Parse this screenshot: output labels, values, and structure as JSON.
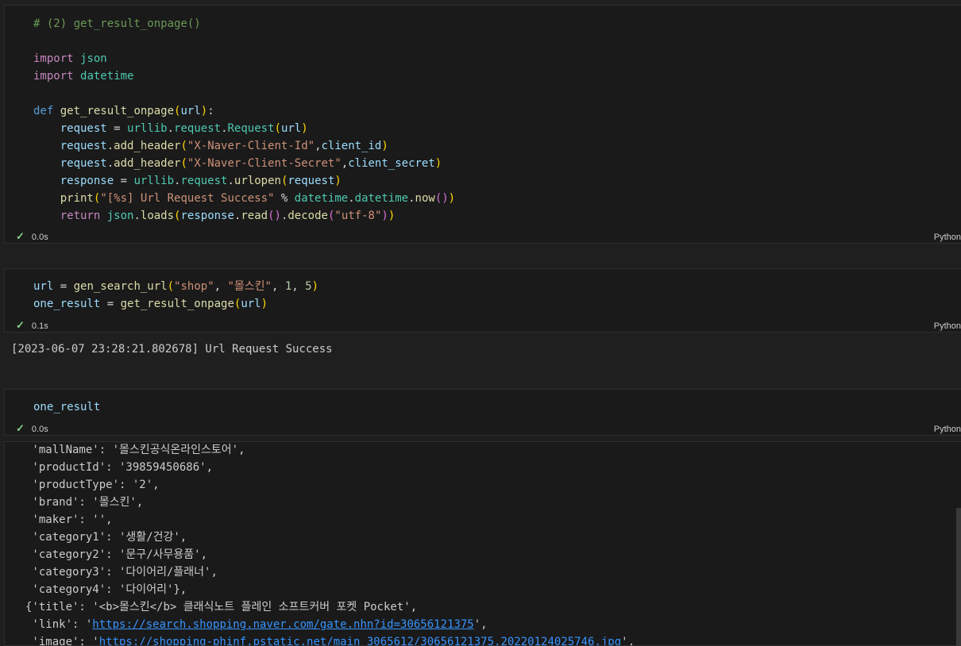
{
  "cell1": {
    "lines": [
      [
        [
          "cm",
          "# (2) get_result_onpage()"
        ]
      ],
      [],
      [
        [
          "ctl",
          "import"
        ],
        [
          "op",
          " "
        ],
        [
          "md",
          "json"
        ]
      ],
      [
        [
          "ctl",
          "import"
        ],
        [
          "op",
          " "
        ],
        [
          "md",
          "datetime"
        ]
      ],
      [],
      [
        [
          "kw",
          "def"
        ],
        [
          "op",
          " "
        ],
        [
          "fn",
          "get_result_onpage"
        ],
        [
          "b1",
          "("
        ],
        [
          "var",
          "url"
        ],
        [
          "b1",
          ")"
        ],
        [
          "op",
          ":"
        ]
      ],
      [
        [
          "op",
          "    "
        ],
        [
          "var",
          "request"
        ],
        [
          "op",
          " = "
        ],
        [
          "md",
          "urllib"
        ],
        [
          "op",
          "."
        ],
        [
          "md",
          "request"
        ],
        [
          "op",
          "."
        ],
        [
          "md",
          "Request"
        ],
        [
          "b1",
          "("
        ],
        [
          "var",
          "url"
        ],
        [
          "b1",
          ")"
        ]
      ],
      [
        [
          "op",
          "    "
        ],
        [
          "var",
          "request"
        ],
        [
          "op",
          "."
        ],
        [
          "fn",
          "add_header"
        ],
        [
          "b1",
          "("
        ],
        [
          "str",
          "\"X-Naver-Client-Id\""
        ],
        [
          "op",
          ","
        ],
        [
          "var",
          "client_id"
        ],
        [
          "b1",
          ")"
        ]
      ],
      [
        [
          "op",
          "    "
        ],
        [
          "var",
          "request"
        ],
        [
          "op",
          "."
        ],
        [
          "fn",
          "add_header"
        ],
        [
          "b1",
          "("
        ],
        [
          "str",
          "\"X-Naver-Client-Secret\""
        ],
        [
          "op",
          ","
        ],
        [
          "var",
          "client_secret"
        ],
        [
          "b1",
          ")"
        ]
      ],
      [
        [
          "op",
          "    "
        ],
        [
          "var",
          "response"
        ],
        [
          "op",
          " = "
        ],
        [
          "md",
          "urllib"
        ],
        [
          "op",
          "."
        ],
        [
          "md",
          "request"
        ],
        [
          "op",
          "."
        ],
        [
          "fn",
          "urlopen"
        ],
        [
          "b1",
          "("
        ],
        [
          "var",
          "request"
        ],
        [
          "b1",
          ")"
        ]
      ],
      [
        [
          "op",
          "    "
        ],
        [
          "fn",
          "print"
        ],
        [
          "b1",
          "("
        ],
        [
          "str",
          "\"[%s] Url Request Success\""
        ],
        [
          "op",
          " % "
        ],
        [
          "md",
          "datetime"
        ],
        [
          "op",
          "."
        ],
        [
          "md",
          "datetime"
        ],
        [
          "op",
          "."
        ],
        [
          "fn",
          "now"
        ],
        [
          "b2",
          "()"
        ],
        [
          "b1",
          ")"
        ]
      ],
      [
        [
          "op",
          "    "
        ],
        [
          "ctl",
          "return"
        ],
        [
          "op",
          " "
        ],
        [
          "md",
          "json"
        ],
        [
          "op",
          "."
        ],
        [
          "fn",
          "loads"
        ],
        [
          "b1",
          "("
        ],
        [
          "var",
          "response"
        ],
        [
          "op",
          "."
        ],
        [
          "fn",
          "read"
        ],
        [
          "b2",
          "()"
        ],
        [
          "op",
          "."
        ],
        [
          "fn",
          "decode"
        ],
        [
          "b2",
          "("
        ],
        [
          "str",
          "\"utf-8\""
        ],
        [
          "b2",
          ")"
        ],
        [
          "b1",
          ")"
        ]
      ]
    ],
    "time": "0.0s",
    "lang": "Python"
  },
  "cell2": {
    "lines": [
      [
        [
          "var",
          "url"
        ],
        [
          "op",
          " = "
        ],
        [
          "fn",
          "gen_search_url"
        ],
        [
          "b1",
          "("
        ],
        [
          "str",
          "\"shop\""
        ],
        [
          "op",
          ", "
        ],
        [
          "str",
          "\"몰스킨\""
        ],
        [
          "op",
          ", "
        ],
        [
          "num",
          "1"
        ],
        [
          "op",
          ", "
        ],
        [
          "num",
          "5"
        ],
        [
          "b1",
          ")"
        ]
      ],
      [
        [
          "var",
          "one_result"
        ],
        [
          "op",
          " = "
        ],
        [
          "fn",
          "get_result_onpage"
        ],
        [
          "b1",
          "("
        ],
        [
          "var",
          "url"
        ],
        [
          "b1",
          ")"
        ]
      ]
    ],
    "time": "0.1s",
    "lang": "Python",
    "output": "[2023-06-07 23:28:21.802678] Url Request Success"
  },
  "cell3": {
    "lines": [
      [
        [
          "var",
          "one_result"
        ]
      ]
    ],
    "time": "0.0s",
    "lang": "Python"
  },
  "output3": {
    "lines": [
      [
        [
          "t",
          " 'mallName': '몰스킨공식온라인스토어',"
        ]
      ],
      [
        [
          "t",
          " 'productId': '39859450686',"
        ]
      ],
      [
        [
          "t",
          " 'productType': '2',"
        ]
      ],
      [
        [
          "t",
          " 'brand': '몰스킨',"
        ]
      ],
      [
        [
          "t",
          " 'maker': '',"
        ]
      ],
      [
        [
          "t",
          " 'category1': '생활/건강',"
        ]
      ],
      [
        [
          "t",
          " 'category2': '문구/사무용품',"
        ]
      ],
      [
        [
          "t",
          " 'category3': '다이어리/플래너',"
        ]
      ],
      [
        [
          "t",
          " 'category4': '다이어리'},"
        ]
      ],
      [
        [
          "t",
          "{'title': '<b>몰스킨</b> 클래식노트 플레인 소프트커버 포켓 Pocket',"
        ]
      ],
      [
        [
          "t",
          " 'link': '"
        ],
        [
          "link",
          "https://search.shopping.naver.com/gate.nhn?id=30656121375"
        ],
        [
          "t",
          "',"
        ]
      ],
      [
        [
          "t",
          " 'image': '"
        ],
        [
          "link",
          "https://shopping-phinf.pstatic.net/main_3065612/30656121375.20220124025746.jpg"
        ],
        [
          "t",
          "',"
        ]
      ]
    ]
  }
}
